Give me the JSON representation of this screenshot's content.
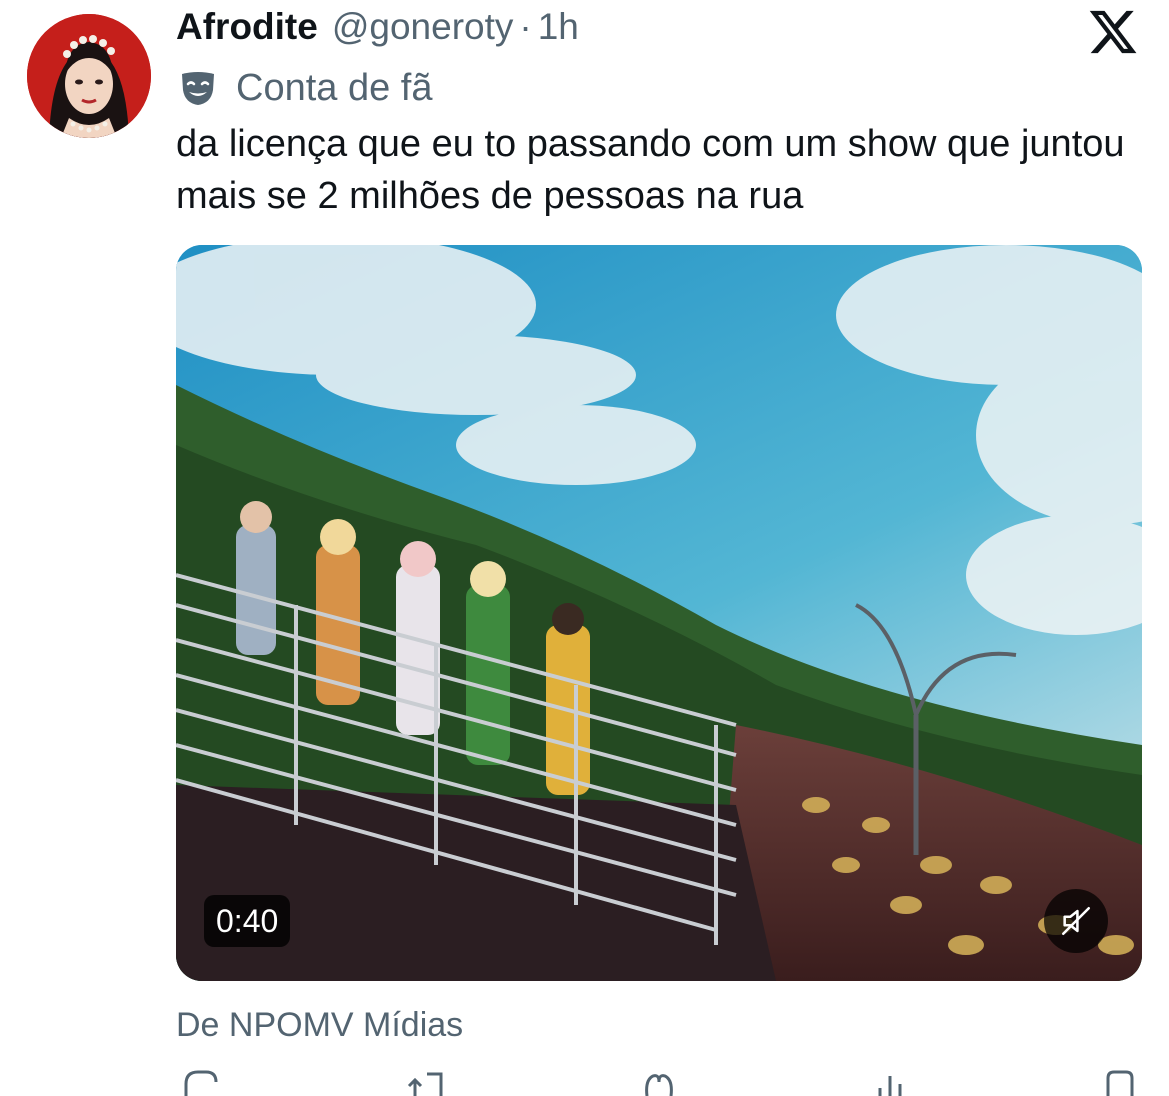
{
  "tweet": {
    "display_name": "Afrodite",
    "handle": "@goneroty",
    "separator": "·",
    "time": "1h",
    "account_label": "Conta de fã",
    "text": "da licença que eu to passando com um show que juntou mais se 2 milhões de pessoas na rua",
    "media": {
      "duration": "0:40",
      "muted": true
    },
    "source": "De NPOMV Mídias"
  },
  "icons": {
    "logo": "x-logo-icon",
    "label": "theater-mask-icon",
    "mute": "speaker-muted-icon",
    "actions": [
      "reply-icon",
      "retweet-icon",
      "like-icon",
      "views-icon",
      "share-icon"
    ]
  },
  "colors": {
    "text": "#0f1419",
    "secondary": "#536471",
    "avatar_bg": "#c51f1b"
  }
}
